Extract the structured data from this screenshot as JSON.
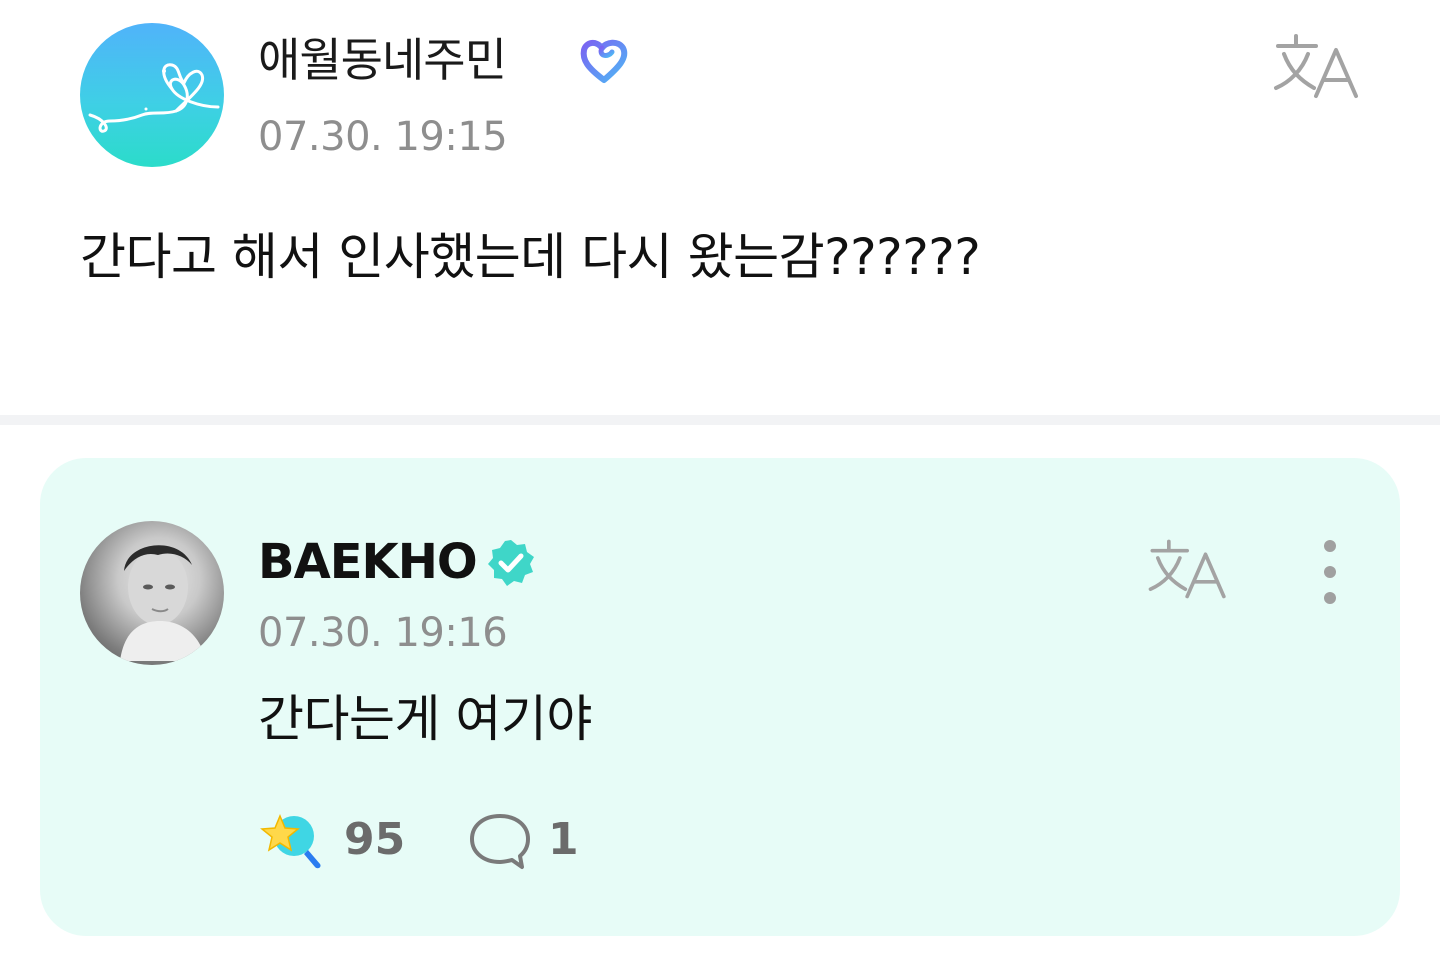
{
  "post": {
    "author_name": "애월동네주민",
    "timestamp": "07.30. 19:15",
    "body": "간다고 해서 인사했는데 다시 왔는감??????",
    "translate_icon": "translate-icon",
    "badge_icon": "fan-membership-heart-badge",
    "avatar_icon": "heart-doodle-avatar"
  },
  "reply": {
    "author_name": "BAEKHO",
    "timestamp": "07.30. 19:16",
    "body": "간다는게 여기야",
    "verified_icon": "verified-check-badge",
    "translate_icon": "translate-icon",
    "more_icon": "more-vertical-icon",
    "like_icon": "star-cheer-icon",
    "like_count": "95",
    "comment_icon": "comment-bubble-icon",
    "comment_count": "1"
  },
  "colors": {
    "card_background": "#e7fcf7",
    "divider": "#f2f3f5",
    "verified_badge": "#3fd6c8",
    "muted_text": "#8e8e8e"
  }
}
